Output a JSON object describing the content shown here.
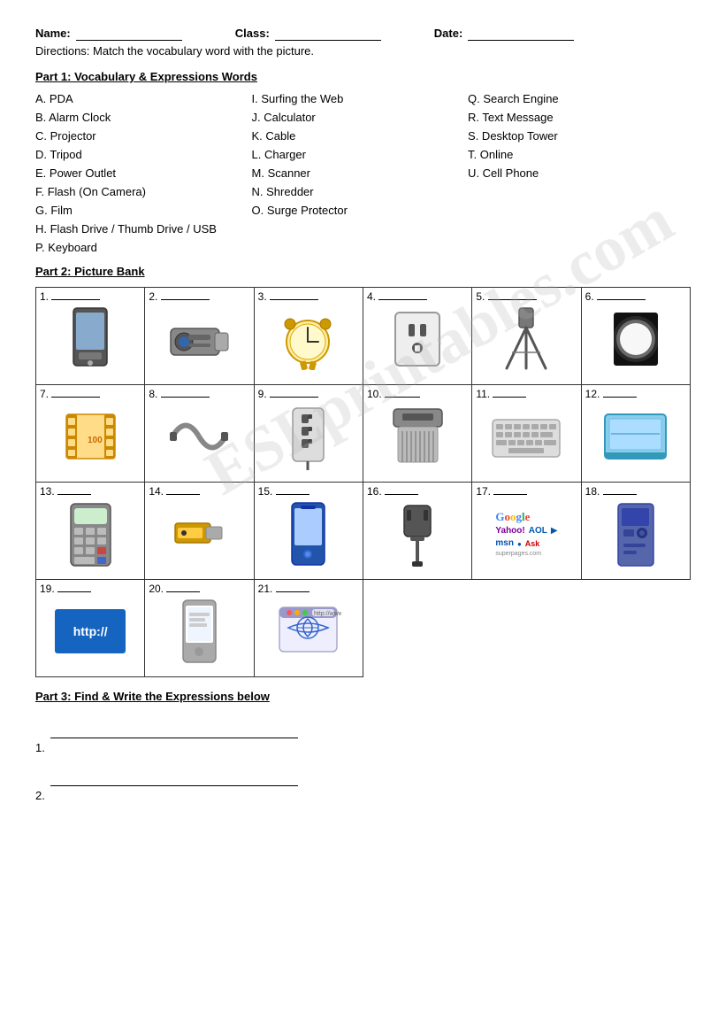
{
  "header": {
    "name_label": "Name:",
    "class_label": "Class:",
    "date_label": "Date:",
    "directions": "Directions: Match the vocabulary word with the picture."
  },
  "part1": {
    "title": "Part 1: Vocabulary & Expressions Words",
    "vocab": [
      {
        "col": 1,
        "items": [
          "A. PDA",
          "B. Alarm Clock",
          "C.  Projector",
          "D. Tripod",
          "E. Power Outlet",
          "F. Flash (On Camera)",
          "G. Film",
          "H.  Flash Drive / Thumb Drive / USB"
        ]
      },
      {
        "col": 2,
        "items": [
          "I. Surfing the Web",
          "J. Calculator",
          "K. Cable",
          "L. Charger",
          "M. Scanner",
          "N. Shredder",
          "O. Surge Protector",
          "P. Keyboard"
        ]
      },
      {
        "col": 3,
        "items": [
          "Q. Search Engine",
          "R. Text Message",
          "S. Desktop Tower",
          "T. Online",
          "U. Cell Phone",
          "",
          "",
          ""
        ]
      }
    ]
  },
  "part2": {
    "title": "Part 2: Picture Bank",
    "cells": [
      {
        "num": "1.",
        "desc": "PDA / handheld device"
      },
      {
        "num": "2.",
        "desc": "Projector"
      },
      {
        "num": "3.",
        "desc": "Alarm Clock"
      },
      {
        "num": "4.",
        "desc": "Power Outlet"
      },
      {
        "num": "5.",
        "desc": "Tripod"
      },
      {
        "num": "6.",
        "desc": "Flash / bright light"
      },
      {
        "num": "7.",
        "desc": "Film roll"
      },
      {
        "num": "8.",
        "desc": "Cable / wire"
      },
      {
        "num": "9.",
        "desc": "Surge Protector"
      },
      {
        "num": "10.",
        "desc": "Shredder"
      },
      {
        "num": "11.",
        "desc": "Keyboard"
      },
      {
        "num": "12.",
        "desc": "Scanner"
      },
      {
        "num": "13.",
        "desc": "Calculator"
      },
      {
        "num": "14.",
        "desc": "Flash Drive"
      },
      {
        "num": "15.",
        "desc": "Cell Phone"
      },
      {
        "num": "16.",
        "desc": "Charger"
      },
      {
        "num": "17.",
        "desc": "Search Engine"
      },
      {
        "num": "18.",
        "desc": "Desktop Tower"
      },
      {
        "num": "19.",
        "desc": "Online / http"
      },
      {
        "num": "20.",
        "desc": "Text Message"
      },
      {
        "num": "21.",
        "desc": "Surfing the Web"
      }
    ]
  },
  "part3": {
    "title": "Part 3: Find & Write the Expressions below",
    "lines": [
      "1.",
      "2."
    ]
  },
  "watermark": "ESLprintables.com"
}
